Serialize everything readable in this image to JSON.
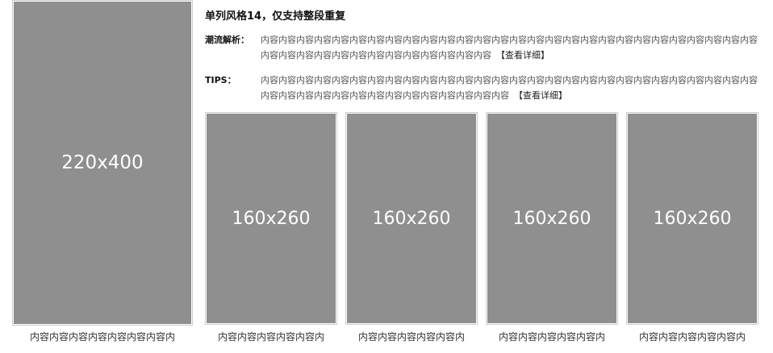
{
  "big_item": {
    "placeholder": "220x400",
    "caption": "内容内容内容内容内容内容内容内"
  },
  "title": "单列风格14，仅支持整段重复",
  "analysis": {
    "label": "潮流解析：",
    "text": "内容内容内容内容内容内容内容内容内容内容内容内容内容内容内容内容内容内容内容内容内容内容内容内容内容内容内容内容内容内容内容内容内容内容内容内容内容内容内容内容内容",
    "more": "【查看详细】"
  },
  "tips": {
    "label": "TIPS：",
    "text": "内容内容内容内容内容内容内容内容内容内容内容内容内容内容内容内容内容内容内容内容内容内容内容内容内容内容内容内容内容内容内容内容内容内容内容内容内容内容内容内容内容内容",
    "more": "【查看详细】"
  },
  "small_items": [
    {
      "placeholder": "160x260",
      "caption": "内容内容内容内容内容内"
    },
    {
      "placeholder": "160x260",
      "caption": "内容内容内容内容内容内"
    },
    {
      "placeholder": "160x260",
      "caption": "内容内容内容内容内容内"
    },
    {
      "placeholder": "160x260",
      "caption": "内容内容内容内容内容内"
    }
  ],
  "colors": {
    "placeholder_bg": "#8f8f8f",
    "placeholder_text": "#ffffff",
    "border": "#cccccc"
  }
}
